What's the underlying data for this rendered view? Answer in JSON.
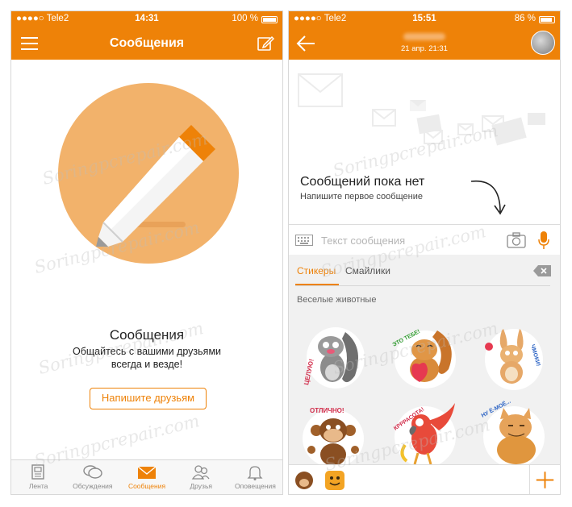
{
  "left": {
    "status": {
      "carrier": "●●●●○ Tele2",
      "time": "14:31",
      "battery": "100 %"
    },
    "nav": {
      "title": "Сообщения"
    },
    "empty": {
      "title": "Сообщения",
      "subtitle_line1": "Общайтесь с вашими друзьями",
      "subtitle_line2": "всегда и везде!",
      "button": "Напишите друзьям"
    },
    "tabs": [
      {
        "label": "Лента",
        "icon": "feed-icon"
      },
      {
        "label": "Обсуждения",
        "icon": "discussions-icon"
      },
      {
        "label": "Сообщения",
        "icon": "messages-icon"
      },
      {
        "label": "Друзья",
        "icon": "friends-icon"
      },
      {
        "label": "Оповещения",
        "icon": "bell-icon"
      }
    ]
  },
  "right": {
    "status": {
      "carrier": "●●●●○ Tele2",
      "time": "15:51",
      "battery": "86 %"
    },
    "nav": {
      "date": "21 апр. 21:31"
    },
    "empty": {
      "title": "Сообщений пока нет",
      "subtitle": "Напишите первое сообщение"
    },
    "composer": {
      "placeholder": "Текст сообщения"
    },
    "sticker_tabs": [
      "Стикеры",
      "Смайлики"
    ],
    "category": "Веселые животные",
    "stickers": [
      {
        "name": "squirrel-kiss-sticker",
        "caption": "ЦЕЛУЮ!"
      },
      {
        "name": "squirrel-heart-sticker",
        "caption": "ЭТО ТЕБЕ!"
      },
      {
        "name": "rabbit-sticker",
        "caption": "ЧМОКИ!"
      },
      {
        "name": "monkey-sticker",
        "caption": "ОТЛИЧНО!"
      },
      {
        "name": "parrot-sticker",
        "caption": "КРРРАСОТА!"
      },
      {
        "name": "cat-sticker",
        "caption": "НУ Ё-МОЁ..."
      }
    ]
  },
  "watermark": "Soringpcrepair.com",
  "colors": {
    "accent": "#ee8208",
    "circle": "#f2b26b"
  }
}
